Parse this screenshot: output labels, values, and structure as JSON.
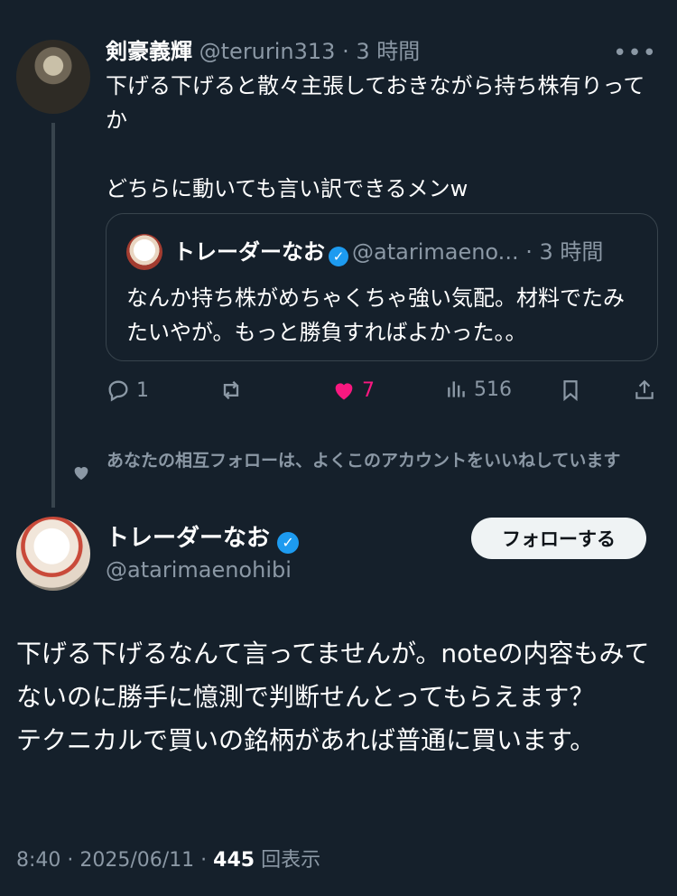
{
  "reply": {
    "display_name": "剣豪義輝",
    "handle": "@terurin313",
    "separator": " · ",
    "time": "3 時間",
    "text": "下げる下げると散々主張しておきながら持ち株有りってか\n\nどちらに動いても言い訳できるメンw",
    "more_icon": "more-horizontal-icon",
    "quoted": {
      "display_name": "トレーダーなお",
      "handle": "@atarimaeno...",
      "separator": " · ",
      "time": "3 時間",
      "text": "なんか持ち株がめちゃくちゃ強い気配。材料でたみたいやが。もっと勝負すればよかった。。"
    },
    "actions": {
      "reply_count": "1",
      "repost_count": "",
      "like_count": "7",
      "view_count": "516"
    }
  },
  "social_context": "あなたの相互フォローは、よくこのアカウントをいいねしています",
  "main": {
    "display_name": "トレーダーなお",
    "handle": "@atarimaenohibi",
    "follow_label": "フォローする",
    "text": "下げる下げるなんて言ってませんが。noteの内容もみてないのに勝手に憶測で判断せんとってもらえます？\nテクニカルで買いの銘柄があれば普通に買います。",
    "timestamp": "8:40 · 2025/06/11 · ",
    "views": "445",
    "views_label": " 回表示"
  },
  "colors": {
    "background": "#15202b",
    "muted": "#8b98a5",
    "like": "#f91880",
    "verified": "#1d9bf0",
    "border": "#38444d"
  }
}
